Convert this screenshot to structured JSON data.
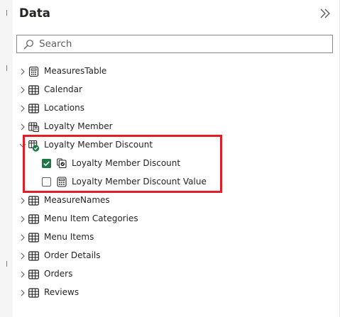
{
  "pane": {
    "title": "Data",
    "collapse_icon": "double-chevron-right-icon"
  },
  "search": {
    "placeholder": "Search",
    "icon": "search-icon"
  },
  "colors": {
    "highlight": "#e01e25",
    "checkbox_checked": "#1b7744",
    "text": "#252423",
    "search_border": "#8a8886"
  },
  "tables": [
    {
      "label": "MeasuresTable",
      "icon": "measures-table-icon",
      "expanded": false
    },
    {
      "label": "Calendar",
      "icon": "table-icon",
      "expanded": false
    },
    {
      "label": "Locations",
      "icon": "table-icon",
      "expanded": false
    },
    {
      "label": "Loyalty Member",
      "icon": "calculated-table-icon",
      "expanded": false
    },
    {
      "label": "Loyalty Member Discount",
      "icon": "calculated-table-with-check-icon",
      "expanded": true,
      "children": [
        {
          "label": "Loyalty Member Discount",
          "checked": true,
          "icon": "parameter-field-icon"
        },
        {
          "label": "Loyalty Member Discount Value",
          "checked": false,
          "icon": "measure-icon"
        }
      ]
    },
    {
      "label": "MeasureNames",
      "icon": "table-icon",
      "expanded": false
    },
    {
      "label": "Menu Item Categories",
      "icon": "table-icon",
      "expanded": false
    },
    {
      "label": "Menu Items",
      "icon": "table-icon",
      "expanded": false
    },
    {
      "label": "Order Details",
      "icon": "table-icon",
      "expanded": false
    },
    {
      "label": "Orders",
      "icon": "table-icon",
      "expanded": false
    },
    {
      "label": "Reviews",
      "icon": "table-icon",
      "expanded": false
    }
  ]
}
